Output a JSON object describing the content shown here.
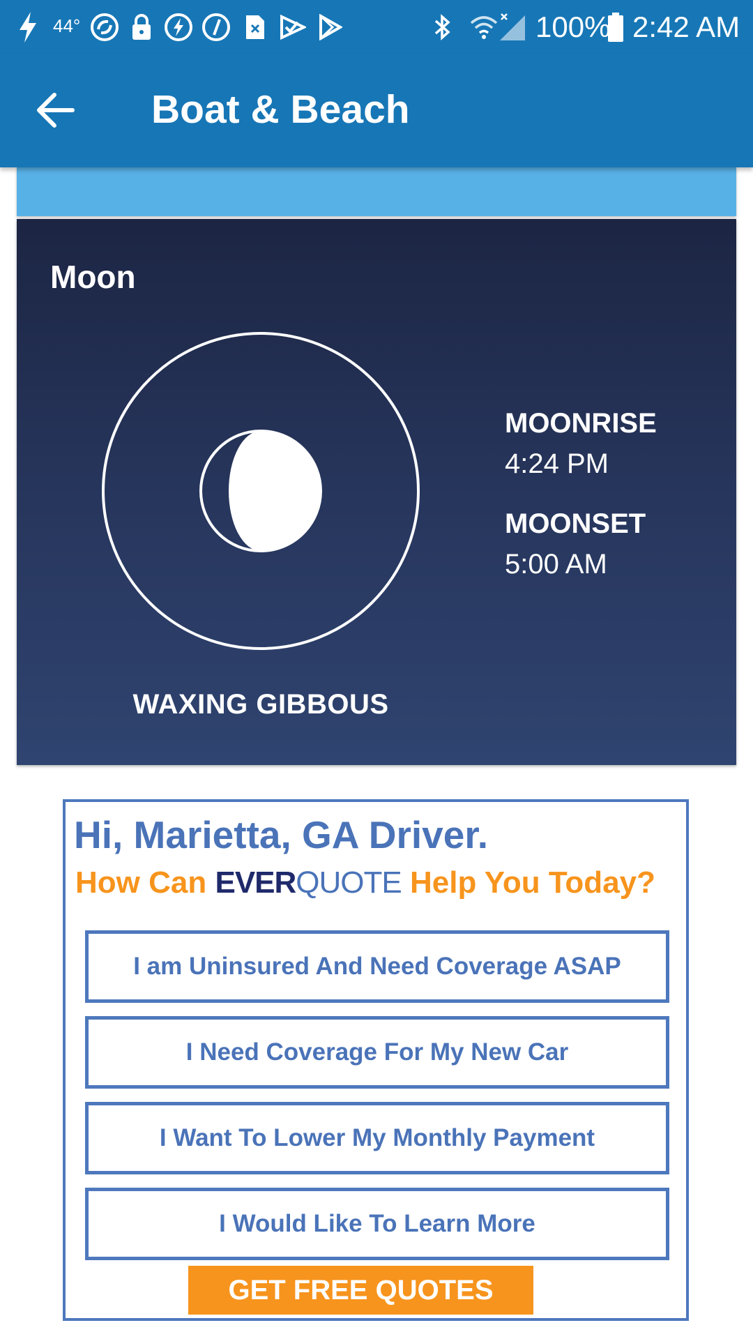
{
  "status_bar": {
    "temperature": "44°",
    "battery_percent": "100%",
    "time": "2:42 AM",
    "left_icons": [
      "charging-bolt-icon",
      "temperature-text",
      "sync-icon",
      "lock-icon",
      "flash-app-icon",
      "compass-app-icon",
      "sim-card-icon",
      "check-app-icon",
      "play-store-icon"
    ],
    "right_icons": [
      "bluetooth-icon",
      "wifi-icon",
      "signal-no-service-icon",
      "battery-icon"
    ]
  },
  "app_bar": {
    "title": "Boat & Beach",
    "back_icon": "arrow-left-icon"
  },
  "moon": {
    "heading": "Moon",
    "phase": "WAXING GIBBOUS",
    "moonrise_label": "MOONRISE",
    "moonrise_time": "4:24 PM",
    "moonset_label": "MOONSET",
    "moonset_time": "5:00 AM"
  },
  "ad": {
    "greeting": "Hi, Marietta, GA Driver.",
    "question_prefix": "How Can",
    "brand_part1": "EVER",
    "brand_part2": "QUOTE",
    "question_suffix": "Help You Today?",
    "options": [
      "I am Uninsured And Need Coverage ASAP",
      "I Need Coverage For My New Car",
      "I Want To Lower My Monthly Payment",
      "I Would Like To Learn More"
    ],
    "cta": "GET FREE QUOTES"
  },
  "colors": {
    "status_bar": "#1777b6",
    "app_bar": "#1776b5",
    "strip": "#58b1e6",
    "moon_card_top": "#1c2543",
    "moon_card_bottom": "#2f4470",
    "ad_blue": "#4a73b8",
    "ad_orange": "#f7941d",
    "brand_navy": "#1f2a6b"
  }
}
